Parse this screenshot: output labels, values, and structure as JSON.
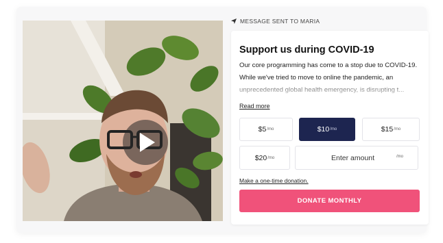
{
  "video": {
    "play_icon": "play-icon"
  },
  "status": {
    "icon": "paper-plane-icon",
    "text": "MESSAGE SENT TO MARIA"
  },
  "donation": {
    "title": "Support us during COVID-19",
    "description": "Our core programming has come to a stop due to COVID-19. While we've tried to move to online the pandemic, an unprecedented global health emergency, is disrupting t...",
    "read_more": "Read more",
    "amounts": [
      {
        "value": "$5",
        "period": "/mo",
        "selected": false
      },
      {
        "value": "$10",
        "period": "/mo",
        "selected": true
      },
      {
        "value": "$15",
        "period": "/mo",
        "selected": false
      },
      {
        "value": "$20",
        "period": "/mo",
        "selected": false
      }
    ],
    "custom_amount": {
      "placeholder": "Enter amount",
      "period": "/mo"
    },
    "one_time_link": "Make a one-time donation.",
    "cta": "DONATE MONTHLY"
  },
  "colors": {
    "selected_amount_bg": "#1d2550",
    "cta_bg": "#f0527a"
  }
}
